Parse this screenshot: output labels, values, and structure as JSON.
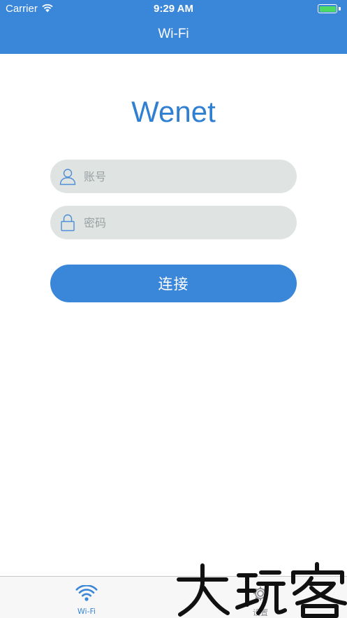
{
  "status_bar": {
    "carrier": "Carrier",
    "time": "9:29 AM",
    "battery_level": 1.0,
    "battery_color": "#4cd964"
  },
  "nav": {
    "title": "Wi-Fi",
    "background_color": "#3a86d8"
  },
  "login": {
    "app_name": "Wenet",
    "account": {
      "placeholder": "账号",
      "value": "",
      "icon": "user-icon"
    },
    "password": {
      "placeholder": "密码",
      "value": "",
      "icon": "lock-icon"
    },
    "connect_label": "连接"
  },
  "tab_bar": {
    "tabs": [
      {
        "label": "Wi-Fi",
        "icon": "wifi-icon",
        "selected": true
      },
      {
        "label": "设置",
        "icon": "gear-icon",
        "selected": false
      }
    ],
    "accent_color": "#3a86d8"
  },
  "watermark": {
    "text": "大玩客"
  }
}
